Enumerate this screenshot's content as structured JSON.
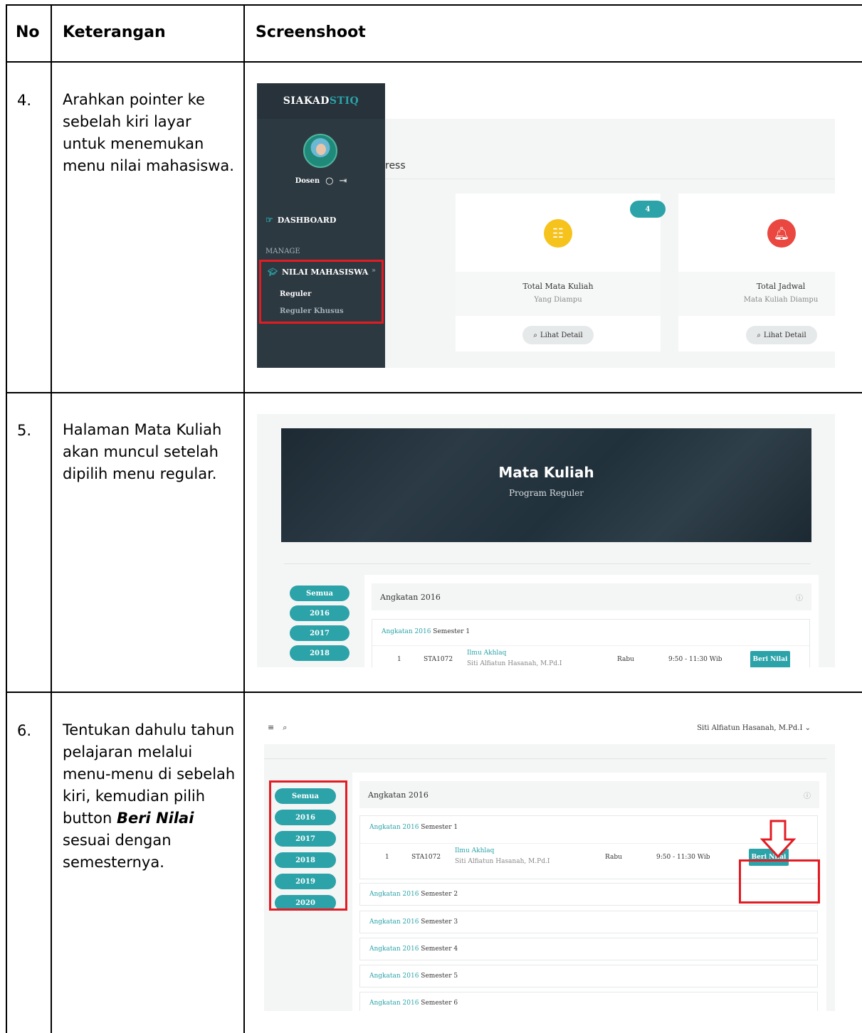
{
  "table": {
    "headers": {
      "no": "No",
      "keterangan": "Keterangan",
      "screenshoot": "Screenshoot"
    },
    "rows": [
      {
        "no": "4.",
        "text": "Arahkan pointer ke sebelah kiri layar untuk menemukan menu nilai mahasiswa."
      },
      {
        "no": "5.",
        "text": "Halaman Mata Kuliah akan muncul setelah dipilih menu regular."
      },
      {
        "no": "6.",
        "text_before": "Tentukan dahulu tahun pelajaran melalui menu-menu di sebelah kiri, kemudian pilih button ",
        "text_emph": "Beri Nilai",
        "text_after": " sesuai dengan semesternya."
      }
    ]
  },
  "shot1": {
    "brand_a": "SIAKAD",
    "brand_b": "STIQ",
    "user_role": "Dosen",
    "dashboard": "DASHBOARD",
    "manage": "MANAGE",
    "nilai": "NILAI MAHASISWA",
    "sub_reguler": "Reguler",
    "sub_reguler_khusus": "Reguler Khusus",
    "ress": "ress",
    "badge": "4",
    "cards": [
      {
        "title": "Total Mata Kuliah",
        "subtitle": "Yang Diampu",
        "detail": "Lihat Detail",
        "color": "#f6c21c"
      },
      {
        "title": "Total Jadwal",
        "subtitle": "Mata Kuliah Diampu",
        "detail": "Lihat Detail",
        "color": "#e9473f"
      }
    ]
  },
  "shot2": {
    "hero_title": "Mata Kuliah",
    "hero_sub": "Program Reguler",
    "years": [
      "Semua",
      "2016",
      "2017",
      "2018"
    ],
    "panel_title": "Angkatan 2016",
    "semester": {
      "angkatan": "Angkatan 2016",
      "label": "Semester 1"
    },
    "course": {
      "no": "1",
      "code": "STA1072",
      "name": "Ilmu Akhlaq",
      "lecturer": "Siti Alfiatun Hasanah, M.Pd.I",
      "day": "Rabu",
      "time": "9:50 - 11:30 Wib",
      "action": "Beri Nilai"
    }
  },
  "shot3": {
    "user_menu": "Siti Alfiatun Hasanah, M.Pd.I",
    "years": [
      "Semua",
      "2016",
      "2017",
      "2018",
      "2019",
      "2020"
    ],
    "panel_title": "Angkatan 2016",
    "course": {
      "no": "1",
      "code": "STA1072",
      "name": "Ilmu Akhlaq",
      "lecturer": "Siti Alfiatun Hasanah, M.Pd.I",
      "day": "Rabu",
      "time": "9:50 - 11:30 Wib",
      "action": "Beri Nilai"
    },
    "semesters": [
      {
        "angkatan": "Angkatan 2016",
        "label": "Semester 1"
      },
      {
        "angkatan": "Angkatan 2016",
        "label": "Semester 2"
      },
      {
        "angkatan": "Angkatan 2016",
        "label": "Semester 3"
      },
      {
        "angkatan": "Angkatan 2016",
        "label": "Semester 4"
      },
      {
        "angkatan": "Angkatan 2016",
        "label": "Semester 5"
      },
      {
        "angkatan": "Angkatan 2016",
        "label": "Semester 6"
      }
    ]
  },
  "colors": {
    "accent": "#2ba3a8",
    "highlight": "#e31b23",
    "sidebar": "#2d3941"
  },
  "icons": {
    "menu": "hamburger-icon",
    "search": "search-icon",
    "help": "help-icon",
    "down_arrow": "down-arrow-icon"
  }
}
